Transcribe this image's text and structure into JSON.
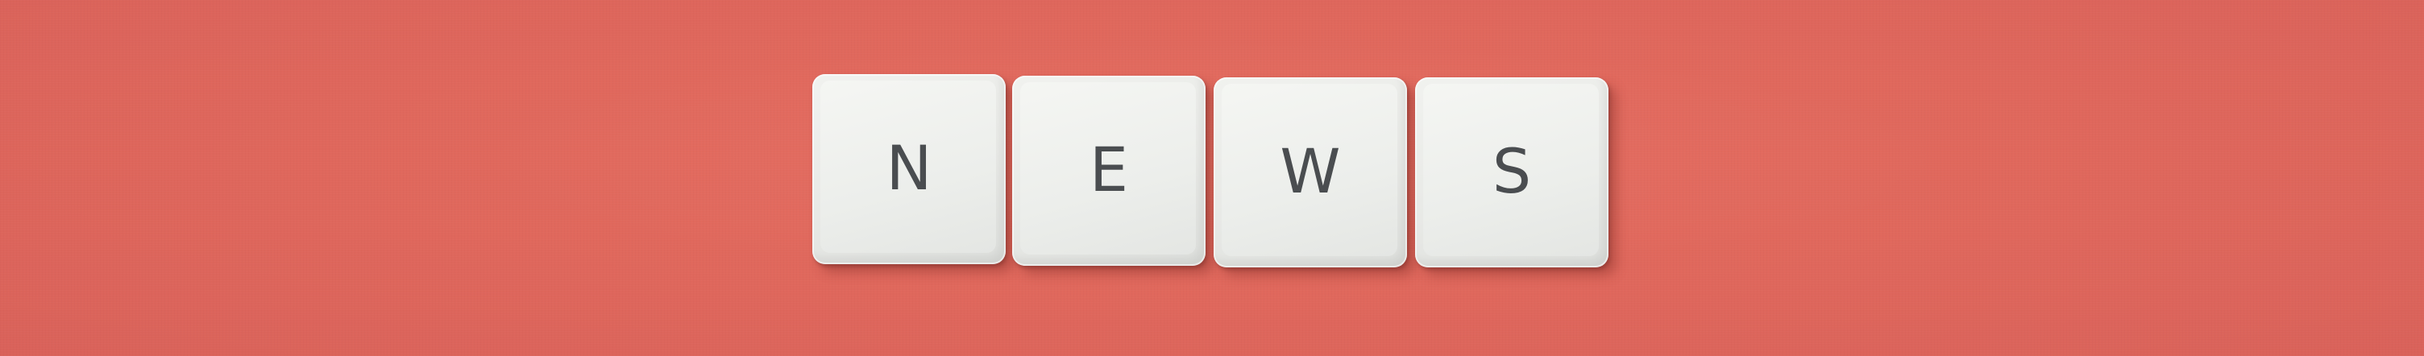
{
  "scene": {
    "background_color": "#e0685c",
    "key_color": "#eceeeb",
    "letter_color": "#4a4d50"
  },
  "keys": [
    {
      "letter": "N"
    },
    {
      "letter": "E"
    },
    {
      "letter": "W"
    },
    {
      "letter": "S"
    }
  ]
}
